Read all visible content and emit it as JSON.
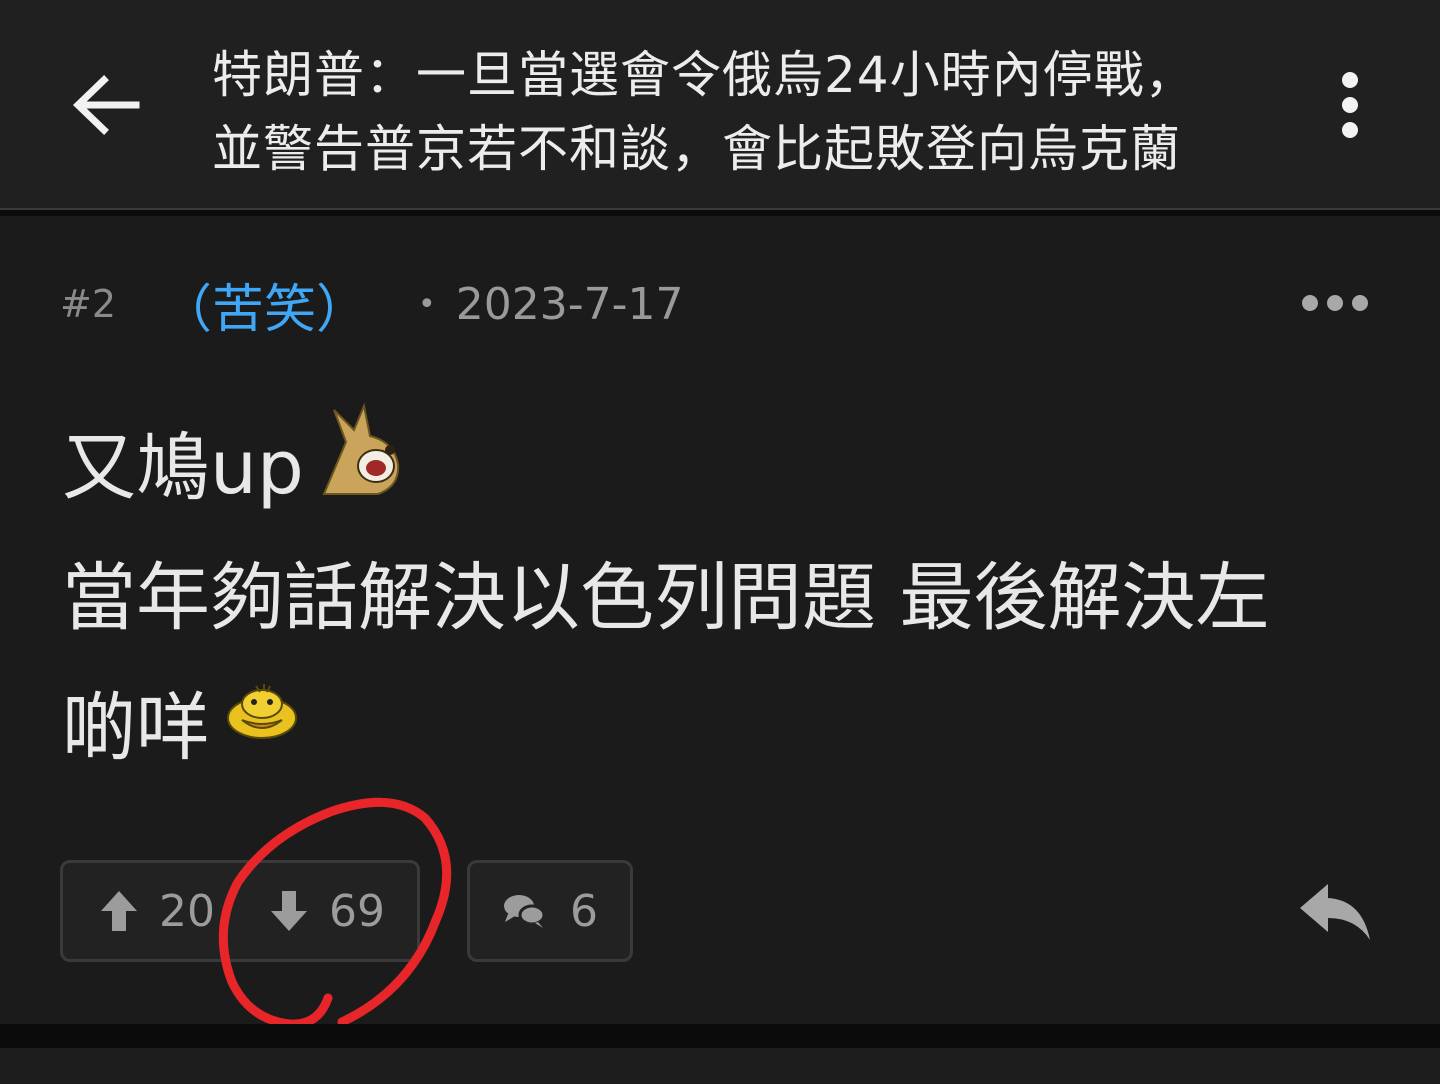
{
  "header": {
    "title_line1": "特朗普：一旦當選會令俄烏24小時內停戰，",
    "title_line2": "並警告普京若不和談，會比起敗登向烏克蘭"
  },
  "post": {
    "floor": "#2",
    "author": "（苦笑）",
    "date": "2023-7-17",
    "content": {
      "line1": "又鳩up",
      "line2": "當年夠話解決以色列問題 最後解決左",
      "line3": "啲咩"
    },
    "upvotes": "20",
    "downvotes": "69",
    "comments": "6"
  },
  "colors": {
    "background": "#1b1b1b",
    "header": "#202020",
    "author": "#3fa7f5",
    "annotation": "#e8262a"
  }
}
